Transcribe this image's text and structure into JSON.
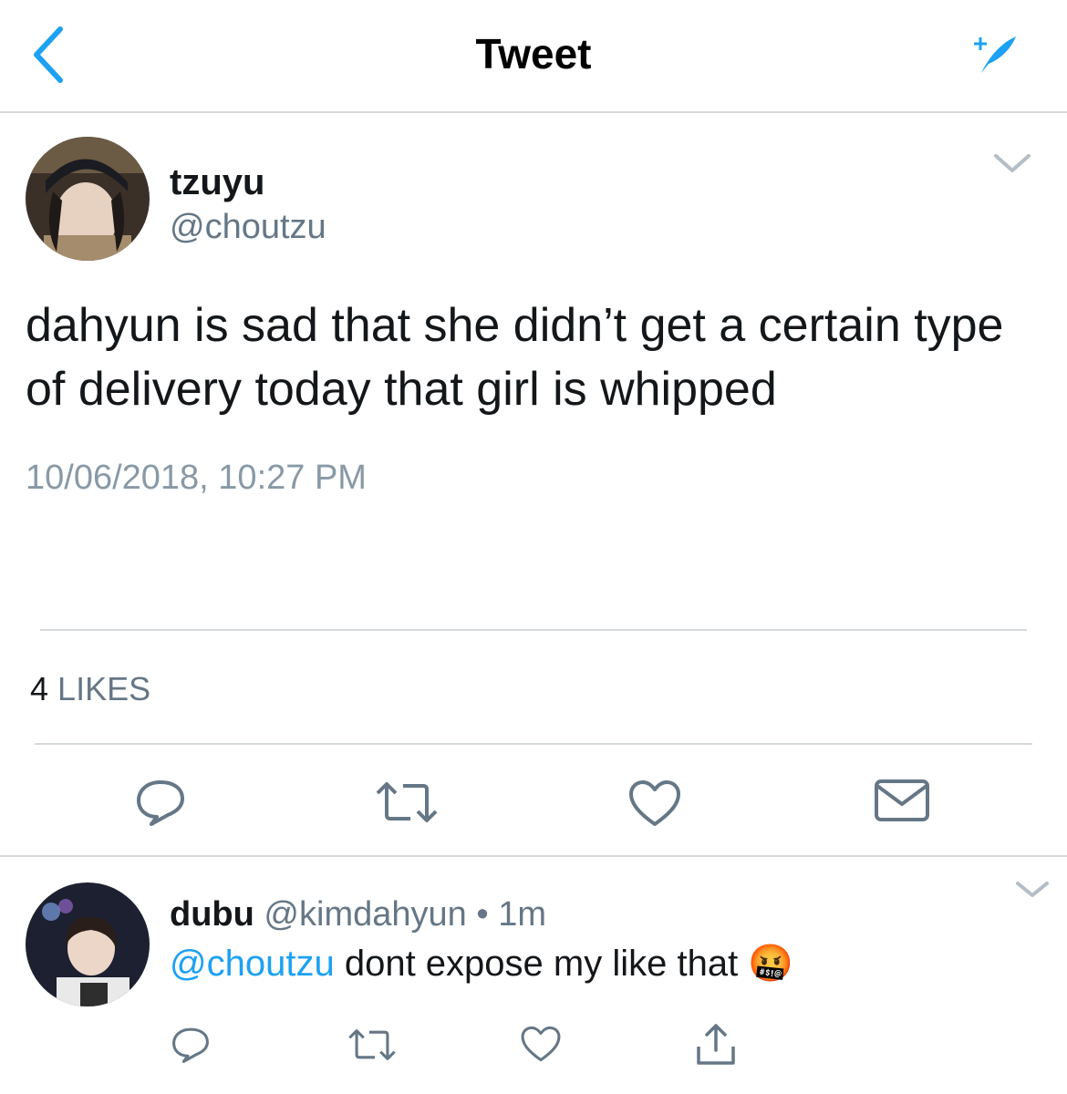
{
  "header": {
    "title": "Tweet"
  },
  "tweet": {
    "author_name": "tzuyu",
    "author_handle": "@choutzu",
    "text": "dahyun is sad that she didn’t get a certain type of delivery today that girl is whipped",
    "timestamp": "10/06/2018, 10:27 PM",
    "likes_count": "4",
    "likes_label": "LIKES"
  },
  "reply": {
    "author_name": "dubu",
    "author_handle": "@kimdahyun",
    "separator": "•",
    "time": "1m",
    "mention": "@choutzu",
    "text": "dont expose my like that",
    "emoji": "🤬"
  },
  "colors": {
    "accent": "#1da1f2",
    "secondary_text": "#657786",
    "divider": "#d6d9dc"
  },
  "icons": [
    "back-chevron-icon",
    "compose-icon",
    "chevron-down-icon",
    "reply-icon",
    "retweet-icon",
    "like-icon",
    "message-icon",
    "share-icon"
  ]
}
